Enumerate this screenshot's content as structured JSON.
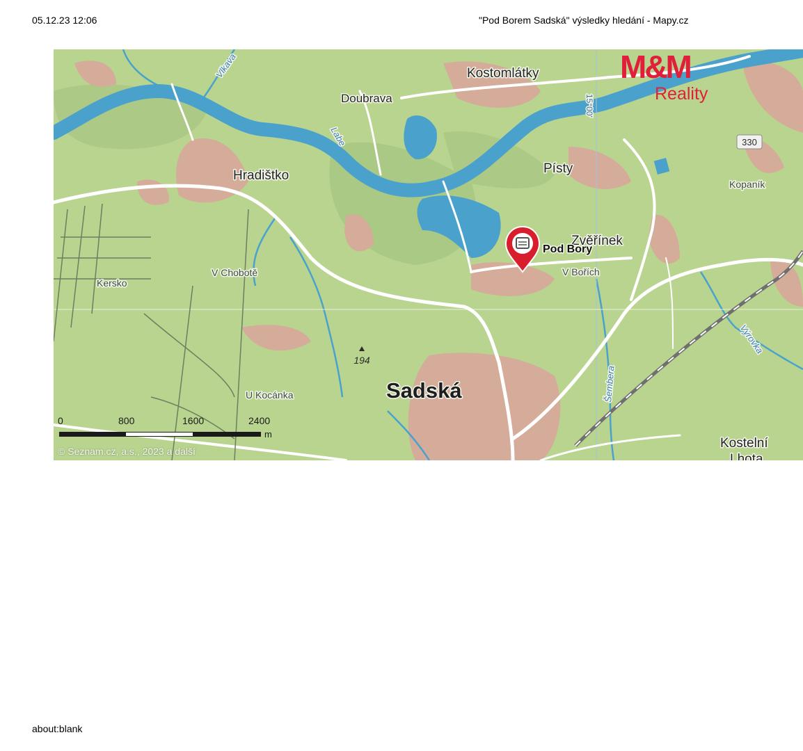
{
  "print_header": {
    "date": "05.12.23 12:06",
    "title": "\"Pod Borem Sadská\" výsledky hledání - Mapy.cz"
  },
  "print_footer": "about:blank",
  "logo": {
    "mark": "M&M",
    "sub": "Reality"
  },
  "map": {
    "marker_label": "Pod Bory",
    "places": {
      "kostomlatky": "Kostomlátky",
      "doubrava": "Doubrava",
      "hradistko": "Hradištko",
      "pisty": "Písty",
      "zverinek": "Zvěřínek",
      "kopanik": "Kopaník",
      "kersko": "Kersko",
      "v_chobote": "V Chobotě",
      "v_borich": "V Bořích",
      "u_kocanka": "U Kocánka",
      "sadska": "Sadská",
      "kostelni_lhota_1": "Kostelní",
      "kostelni_lhota_2": "Lhota"
    },
    "water": {
      "vlkava": "Vlkava",
      "labe": "Labe",
      "vyrovka": "Výrovka",
      "sembera": "Šembera"
    },
    "meridian_label": "15°00'",
    "road_number": "330",
    "elevation": "194",
    "scale": {
      "ticks": [
        "0",
        "800",
        "1600",
        "2400"
      ],
      "unit": "m"
    },
    "copyright": "© Seznam.cz, a.s., 2023 a další",
    "colors": {
      "land": "#b9d48f",
      "urban": "#d5ab9a",
      "water": "#4aa2cc",
      "road": "#ffffff",
      "marker": "#d81e2c",
      "brand": "#e0203a"
    }
  }
}
